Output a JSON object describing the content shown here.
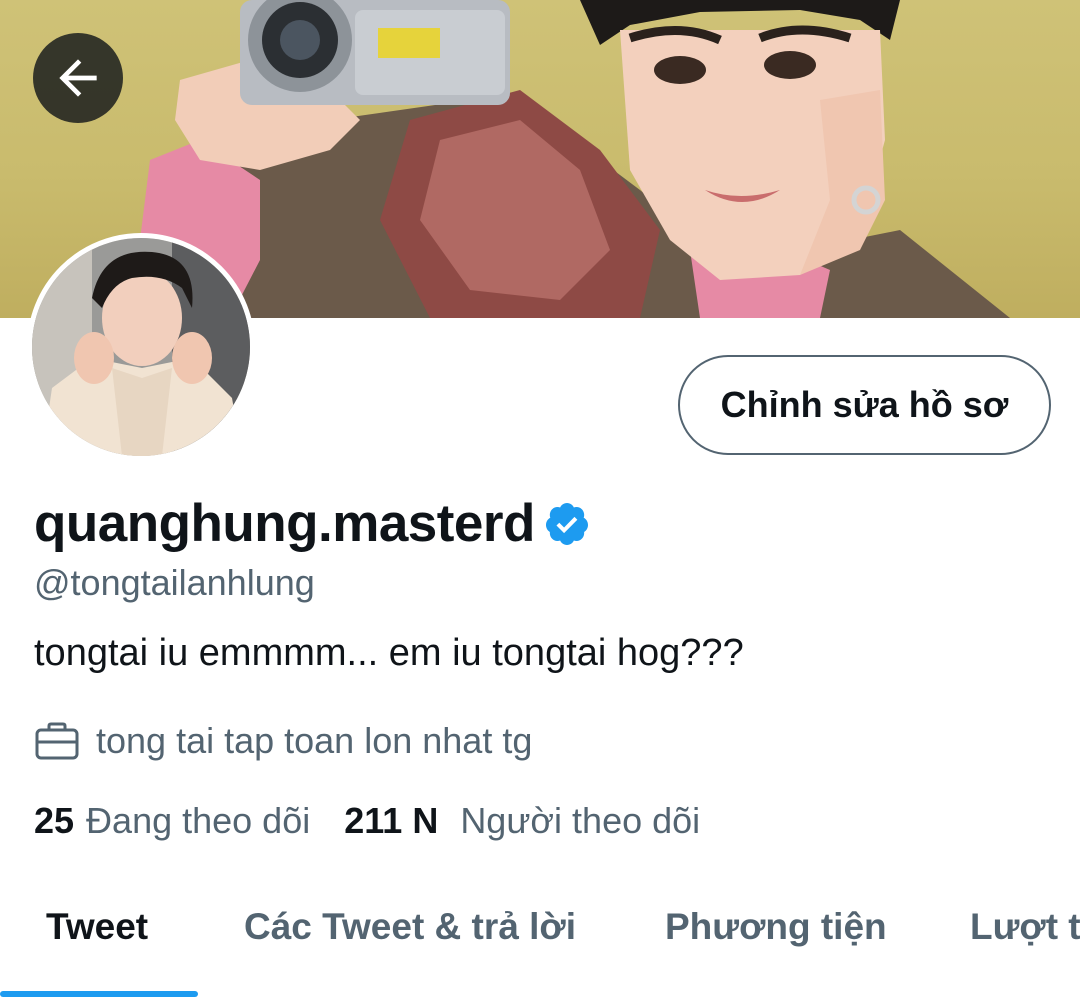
{
  "header": {
    "back_icon": "arrow-left-icon"
  },
  "profile": {
    "edit_button_label": "Chỉnh sửa hồ sơ",
    "display_name": "quanghung.masterd",
    "verified_icon": "verified-badge-icon",
    "handle": "@tongtailanhlung",
    "bio": "tongtai iu emmmm... em iu tongtai hog???",
    "work_icon": "briefcase-icon",
    "work": "tong tai tap toan lon nhat tg",
    "following_count": "25",
    "following_label": "Đang theo dõi",
    "followers_count": "211 N",
    "followers_label": "Người theo dõi"
  },
  "tabs": [
    {
      "label": "Tweet",
      "active": true
    },
    {
      "label": "Các Tweet & trả lời",
      "active": false
    },
    {
      "label": "Phương tiện",
      "active": false
    },
    {
      "label": "Lượt thích",
      "active": false
    }
  ],
  "colors": {
    "accent": "#1d9bf0",
    "text_primary": "#0f1419",
    "text_secondary": "#536471",
    "banner_bg": "#cfc277"
  }
}
